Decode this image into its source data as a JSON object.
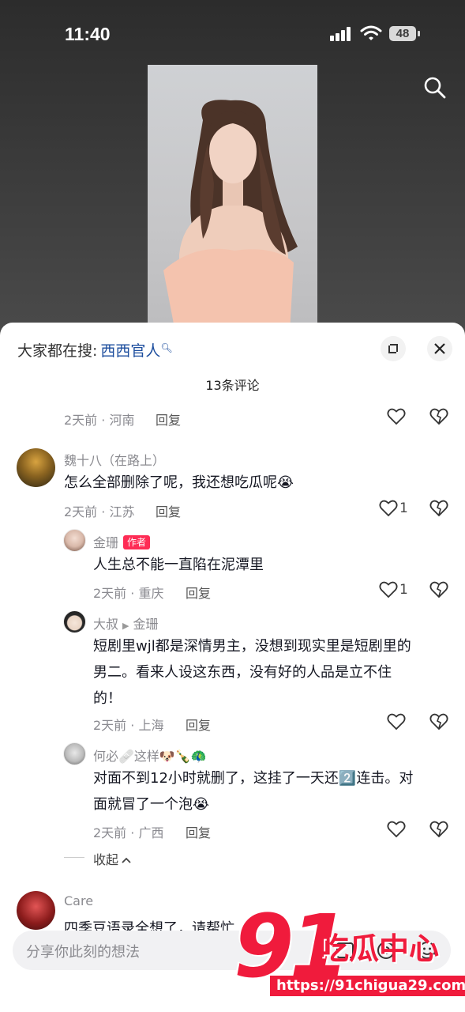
{
  "status_bar": {
    "time": "11:40",
    "battery": "48"
  },
  "panel": {
    "search_prefix": "大家都在搜:",
    "search_term": "西西官人",
    "comment_count": "13条评论"
  },
  "comments": [
    {
      "meta": "2天前 · 河南",
      "reply": "回复"
    },
    {
      "user": "魏十八（在路上）",
      "text": "怎么全部删除了呢，我还想吃瓜呢😭",
      "meta": "2天前 · 江苏",
      "reply": "回复",
      "likes": "1"
    },
    {
      "user": "金珊",
      "author_badge": "作者",
      "text": "人生总不能一直陷在泥潭里",
      "meta": "2天前 · 重庆",
      "reply": "回复",
      "likes": "1"
    },
    {
      "user": "大叔",
      "reply_to": "金珊",
      "text_lines": [
        "短剧里wjl都是深情男主，没想到现实里是短剧里的",
        "男二。看来人设这东西，没有好的人品是立不住",
        "的！"
      ],
      "meta": "2天前 · 上海",
      "reply": "回复"
    },
    {
      "user": "何必🩹这样🐶🍾🦚",
      "text_lines": [
        "对面不到12小时就删了，这挂了一天还2️⃣连击。对",
        "面就冒了一个泡😭"
      ],
      "meta": "2天前 · 广西",
      "reply": "回复"
    },
    {
      "user": "Care",
      "text": "四季豆语录全想了，请帮忙"
    }
  ],
  "collapse_label": "收起",
  "input": {
    "placeholder": "分享你此刻的想法"
  },
  "watermark": {
    "big": "91",
    "cn": "吃瓜中心",
    "url": "https://91chigua29.com"
  },
  "colors": {
    "link": "#1d4e9e",
    "accent": "#fe2c55"
  },
  "icons": [
    "search-icon",
    "expand-icon",
    "close-icon",
    "heart-icon",
    "dislike-icon",
    "chevron-up-icon",
    "at-icon",
    "emoji-icon"
  ]
}
